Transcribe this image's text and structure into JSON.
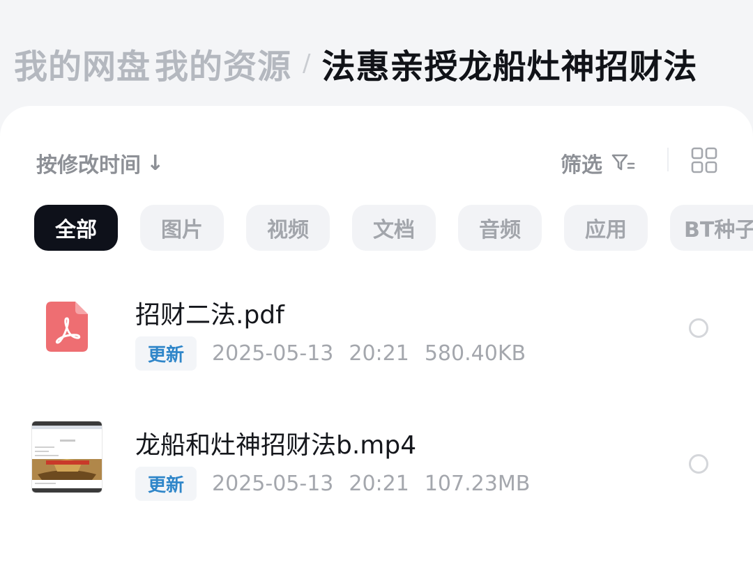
{
  "breadcrumb": {
    "root": "我的网盘",
    "parent": "我的资源",
    "separator": "/",
    "current": "法惠亲授龙船灶神招财法"
  },
  "toolbar": {
    "sort_label": "按修改时间",
    "sort_arrow": "↓",
    "filter_label": "筛选",
    "filter_icon": "filter-icon",
    "view_icon": "grid-icon"
  },
  "categories": [
    {
      "label": "全部",
      "active": true
    },
    {
      "label": "图片",
      "active": false
    },
    {
      "label": "视频",
      "active": false
    },
    {
      "label": "文档",
      "active": false
    },
    {
      "label": "音频",
      "active": false
    },
    {
      "label": "应用",
      "active": false
    },
    {
      "label": "BT种子",
      "active": false
    }
  ],
  "files": [
    {
      "name": "招财二法.pdf",
      "badge": "更新",
      "date": "2025-05-13",
      "time": "20:21",
      "size": "580.40KB",
      "icon": "pdf-icon"
    },
    {
      "name": "龙船和灶神招财法b.mp4",
      "badge": "更新",
      "date": "2025-05-13",
      "time": "20:21",
      "size": "107.23MB",
      "icon": "video-thumbnail"
    }
  ],
  "colors": {
    "accent_text": "#2f86c9",
    "active_chip": "#0e111a",
    "pdf_red": "#ee6e72"
  }
}
